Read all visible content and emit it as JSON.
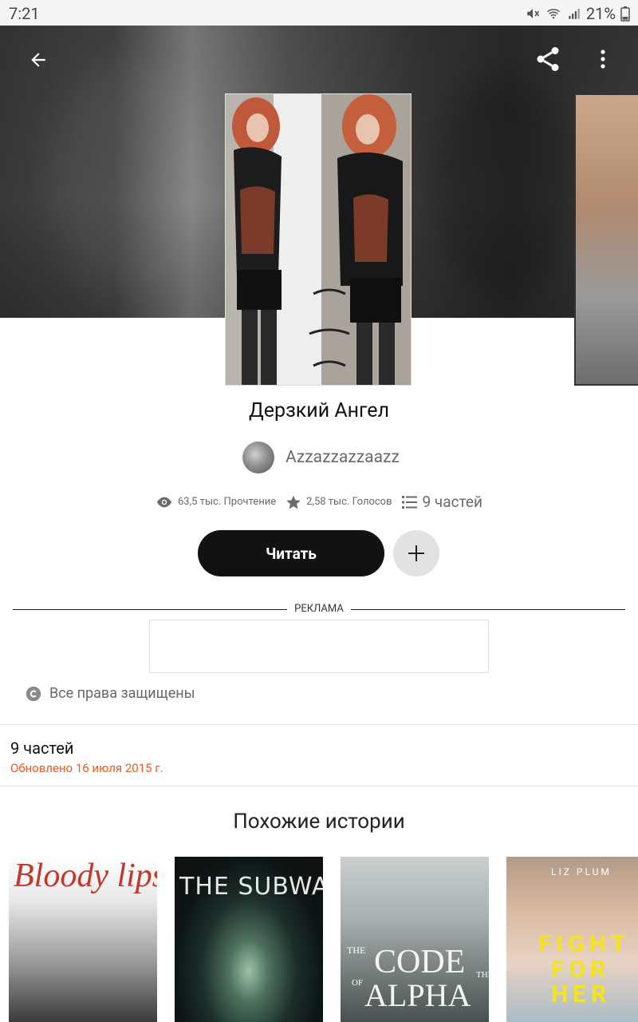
{
  "status_bar": {
    "time": "7:21",
    "battery": "21%"
  },
  "story": {
    "title": "Дерзкий Ангел",
    "author": "Azzazzazzaazz",
    "reads": "63,5 тыс. Прочтение",
    "votes": "2,58 тыс. Голосов",
    "parts": "9 частей",
    "read_label": "Читать"
  },
  "ad": {
    "label": "РЕКЛАМА"
  },
  "rights": {
    "text": "Все права защищены"
  },
  "parts_section": {
    "title": "9 частей",
    "updated": "Обновлено 16 июля 2015 г."
  },
  "similar": {
    "title": "Похожие истории",
    "books": [
      {
        "cover_text": "Bloody lips"
      },
      {
        "cover_text": "THE SUBWAY"
      },
      {
        "cover_text_1": "CODE",
        "cover_text_2": "ALPHA",
        "cover_small_1": "THE",
        "cover_small_2": "OF",
        "cover_small_3": "THE"
      },
      {
        "author": "LIZ PLUM",
        "line1": "FIGHT",
        "line2": "FOR",
        "line3": "HER"
      }
    ]
  },
  "colors": {
    "accent": "#ef5a1c",
    "read_button": "#121212"
  },
  "icons": [
    "back-arrow-icon",
    "share-icon",
    "more-vert-icon",
    "eye-icon",
    "star-icon",
    "list-icon",
    "plus-icon",
    "copyright-icon"
  ]
}
